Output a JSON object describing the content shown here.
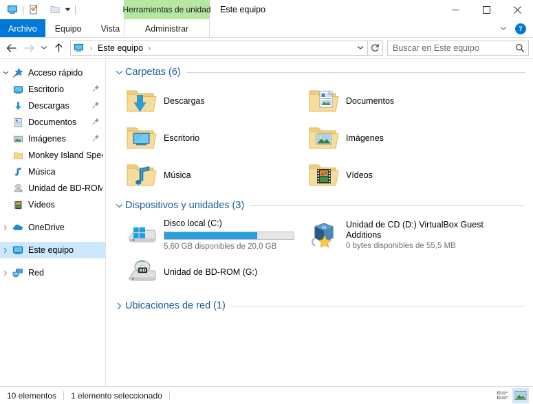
{
  "window": {
    "title": "Este equipo",
    "contextual_tab_banner": "Herramientas de unidad",
    "controls": {
      "minimize": "minimize-button",
      "maximize": "maximize-button",
      "close": "close-button"
    }
  },
  "quick_access_toolbar": {
    "items": [
      {
        "name": "this-pc-icon",
        "tooltip": "Este equipo"
      },
      {
        "name": "properties-icon",
        "tooltip": "Propiedades"
      },
      {
        "name": "new-folder-icon",
        "tooltip": "Nueva carpeta"
      }
    ]
  },
  "ribbon": {
    "tabs": [
      {
        "label": "Archivo",
        "active": false,
        "style": "file"
      },
      {
        "label": "Equipo",
        "active": false,
        "style": "normal"
      },
      {
        "label": "Vista",
        "active": false,
        "style": "normal"
      }
    ],
    "contextual_tab": {
      "label": "Administrar"
    },
    "help_glyph": "?"
  },
  "address_bar": {
    "back_tooltip": "Atrás",
    "forward_tooltip": "Adelante",
    "recent_tooltip": "Ubicaciones recientes",
    "up_tooltip": "Subir un nivel",
    "breadcrumb": [
      {
        "label": "Este equipo"
      }
    ],
    "separator": "›",
    "refresh_tooltip": "Actualizar",
    "search": {
      "value": "",
      "placeholder": "Buscar en Este equipo"
    }
  },
  "sidebar": {
    "items": [
      {
        "label": "Acceso rápido",
        "icon": "pin-star-icon",
        "chevron": "expanded",
        "level": 0,
        "selected": false,
        "pinned": false
      },
      {
        "label": "Escritorio",
        "icon": "desktop-icon",
        "chevron": "none",
        "level": 1,
        "selected": false,
        "pinned": true
      },
      {
        "label": "Descargas",
        "icon": "downloads-icon",
        "chevron": "none",
        "level": 1,
        "selected": false,
        "pinned": true
      },
      {
        "label": "Documentos",
        "icon": "documents-icon",
        "chevron": "none",
        "level": 1,
        "selected": false,
        "pinned": true
      },
      {
        "label": "Imágenes",
        "icon": "pictures-icon",
        "chevron": "none",
        "level": 1,
        "selected": false,
        "pinned": true
      },
      {
        "label": "Monkey Island Spec",
        "icon": "folder-icon",
        "chevron": "none",
        "level": 1,
        "selected": false,
        "pinned": false
      },
      {
        "label": "Música",
        "icon": "music-icon",
        "chevron": "none",
        "level": 1,
        "selected": false,
        "pinned": false
      },
      {
        "label": "Unidad de BD-ROM",
        "icon": "optical-drive-icon",
        "chevron": "none",
        "level": 1,
        "selected": false,
        "pinned": false
      },
      {
        "label": "Vídeos",
        "icon": "videos-icon",
        "chevron": "none",
        "level": 1,
        "selected": false,
        "pinned": false
      },
      {
        "label": "OneDrive",
        "icon": "onedrive-icon",
        "chevron": "collapsed",
        "level": 0,
        "selected": false,
        "pinned": false
      },
      {
        "label": "Este equipo",
        "icon": "this-pc-icon",
        "chevron": "collapsed",
        "level": 0,
        "selected": true,
        "pinned": false
      },
      {
        "label": "Red",
        "icon": "network-icon",
        "chevron": "collapsed",
        "level": 0,
        "selected": false,
        "pinned": false
      }
    ]
  },
  "content": {
    "groups": [
      {
        "id": "folders",
        "title": "Carpetas (6)",
        "expanded": true,
        "kind": "folders",
        "items": [
          {
            "label": "Descargas",
            "icon": "downloads-folder-icon"
          },
          {
            "label": "Documentos",
            "icon": "documents-folder-icon"
          },
          {
            "label": "Escritorio",
            "icon": "desktop-folder-icon"
          },
          {
            "label": "Imágenes",
            "icon": "pictures-folder-icon"
          },
          {
            "label": "Música",
            "icon": "music-folder-icon"
          },
          {
            "label": "Vídeos",
            "icon": "videos-folder-icon"
          }
        ]
      },
      {
        "id": "devices",
        "title": "Dispositivos y unidades (3)",
        "expanded": true,
        "kind": "drives",
        "items": [
          {
            "name": "Disco local (C:)",
            "icon": "hard-drive-icon",
            "has_bar": true,
            "used_percent": 72,
            "sub": "5,60 GB disponibles de 20,0 GB",
            "wide": false
          },
          {
            "name": "Unidad de CD (D:) VirtualBox Guest Additions",
            "icon": "virtualbox-cd-icon",
            "has_bar": false,
            "used_percent": 0,
            "sub": "0 bytes disponibles de 55,5 MB",
            "wide": true
          },
          {
            "name": "Unidad de BD-ROM (G:)",
            "icon": "bd-rom-drive-icon",
            "has_bar": false,
            "used_percent": 0,
            "sub": "",
            "wide": false
          }
        ]
      },
      {
        "id": "network",
        "title": "Ubicaciones de red (1)",
        "expanded": false,
        "kind": "network",
        "items": []
      }
    ]
  },
  "statusbar": {
    "item_count": "10 elementos",
    "selection": "1 elemento seleccionado",
    "views": [
      {
        "name": "details-view-button",
        "active": false
      },
      {
        "name": "large-icons-view-button",
        "active": true
      }
    ]
  },
  "colors": {
    "accent": "#0078d7",
    "group_header": "#195b9e",
    "selection": "#cce8ff",
    "contextual_green": "#b5e6a2",
    "progress_blue": "#26a0da",
    "folder_yellow": "#f5d07c"
  }
}
